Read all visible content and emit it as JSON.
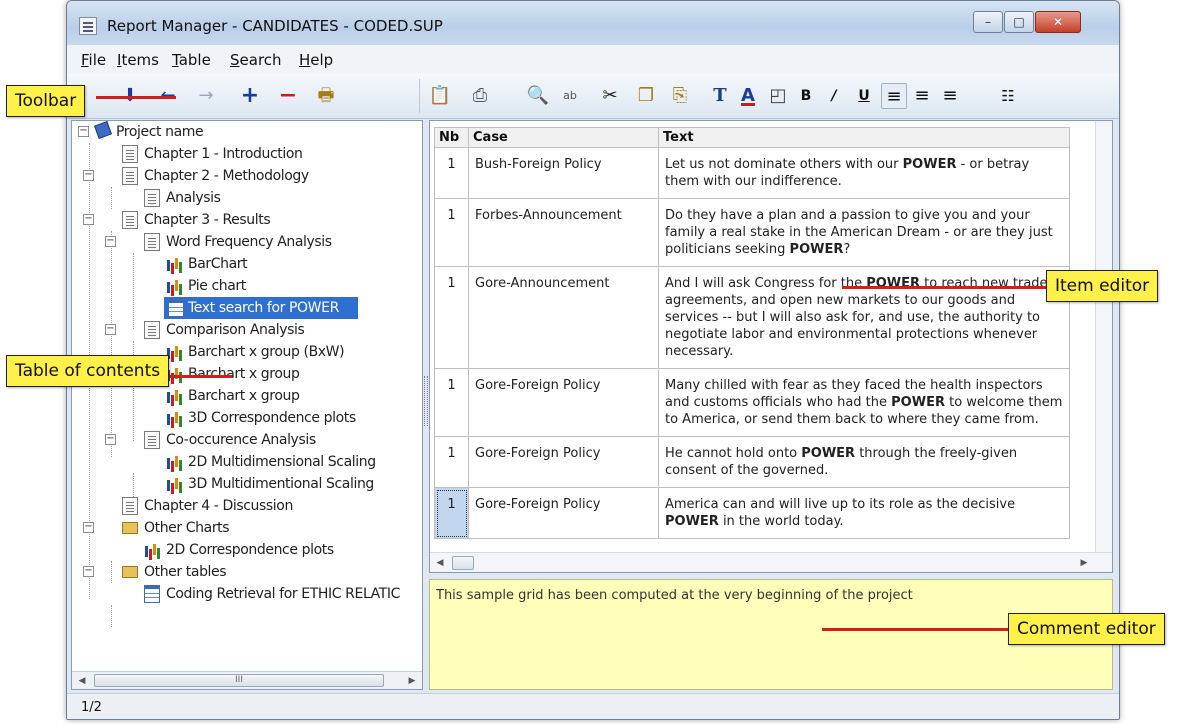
{
  "window": {
    "title": "Report Manager - CANDIDATES - CODED.SUP",
    "buttons": {
      "minimize": "–",
      "maximize": "□",
      "close": "✕"
    }
  },
  "menu": {
    "items": [
      {
        "accel": "F",
        "rest": "ile"
      },
      {
        "accel": "I",
        "rest": "tems"
      },
      {
        "accel": "T",
        "rest": "able"
      },
      {
        "accel": "S",
        "rest": "earch"
      },
      {
        "accel": "H",
        "rest": "elp"
      }
    ]
  },
  "toolbar": {
    "icons": [
      "move-down-arrow-icon",
      "move-left-arrow-icon",
      "move-right-arrow-icon",
      "add-icon",
      "remove-icon",
      "export-icon",
      "copy-to-report-icon",
      "print-icon",
      "find-icon",
      "spelling-icon",
      "cut-icon",
      "copy-icon",
      "paste-icon",
      "font-icon",
      "font-color-icon",
      "fill-color-icon",
      "bold-icon",
      "italic-icon",
      "underline-icon",
      "align-left-icon",
      "align-center-icon",
      "align-right-icon",
      "list-icon"
    ],
    "glyphs": {
      "down": "🡫",
      "left": "←",
      "right": "→",
      "add": "+",
      "remove": "−",
      "bold": "B",
      "italic": "/",
      "underline": "U",
      "cut": "✂",
      "find": "🔭",
      "align_left": "≡",
      "align_center": "≡",
      "align_right": "≡",
      "font": "T",
      "font_color": "A"
    }
  },
  "tree": {
    "items": [
      {
        "label": "Project name",
        "icon": "book"
      },
      {
        "label": "Chapter 1 - Introduction",
        "icon": "doc"
      },
      {
        "label": "Chapter 2 - Methodology",
        "icon": "doc"
      },
      {
        "label": "Analysis",
        "icon": "doc"
      },
      {
        "label": "Chapter 3 - Results",
        "icon": "doc"
      },
      {
        "label": "Word Frequency Analysis",
        "icon": "doc"
      },
      {
        "label": "BarChart",
        "icon": "chart"
      },
      {
        "label": "Pie chart",
        "icon": "chart"
      },
      {
        "label": "Text search for POWER",
        "icon": "table",
        "selected": true
      },
      {
        "label": "Comparison Analysis",
        "icon": "doc"
      },
      {
        "label": "Barchart x group (BxW)",
        "icon": "chart"
      },
      {
        "label": "Barchart x group",
        "icon": "chart"
      },
      {
        "label": "Barchart x group",
        "icon": "chart"
      },
      {
        "label": "3D Correspondence plots",
        "icon": "chart"
      },
      {
        "label": "Co-occurence Analysis",
        "icon": "doc"
      },
      {
        "label": "2D Multidimensional Scaling",
        "icon": "chart"
      },
      {
        "label": "3D Multidimentional Scaling",
        "icon": "chart"
      },
      {
        "label": "Chapter 4 - Discussion",
        "icon": "doc"
      },
      {
        "label": "Other Charts",
        "icon": "folder"
      },
      {
        "label": "2D Correspondence plots",
        "icon": "chart"
      },
      {
        "label": "Other tables",
        "icon": "folder"
      },
      {
        "label": "Coding Retrieval for ETHIC RELATIC",
        "icon": "table"
      }
    ],
    "scroll_thumb": "III"
  },
  "grid": {
    "columns": [
      "Nb",
      "Case",
      "Text"
    ],
    "rows": [
      {
        "nb": "1",
        "case": "Bush-Foreign Policy",
        "pre": "Let us not dominate others with our ",
        "kw": "POWER",
        "post": " - or betray them with our indifference."
      },
      {
        "nb": "1",
        "case": "Forbes-Announcement",
        "pre": "Do they have a plan and a passion to give you and your family a real stake in the American Dream - or are they just politicians seeking ",
        "kw": "POWER",
        "post": "?"
      },
      {
        "nb": "1",
        "case": "Gore-Announcement",
        "pre": "And I will ask Congress for the ",
        "kw": "POWER",
        "post": " to reach new trade agreements, and open new markets to our goods and services -- but I will also ask for, and use, the authority to negotiate labor and environmental protections whenever necessary."
      },
      {
        "nb": "1",
        "case": "Gore-Foreign Policy",
        "pre": "Many chilled with fear as they faced the health inspectors and customs officials who had the ",
        "kw": "POWER",
        "post": " to welcome them to America, or send them back to where they came from."
      },
      {
        "nb": "1",
        "case": "Gore-Foreign Policy",
        "pre": "He cannot hold onto ",
        "kw": "POWER",
        "post": " through the freely-given consent of the governed."
      },
      {
        "nb": "1",
        "case": "Gore-Foreign Policy",
        "pre": "America can and will live up to its role as the decisive ",
        "kw": "POWER",
        "post": " in the world today."
      }
    ]
  },
  "comment": {
    "text": "This sample grid has been computed at the very beginning of the project"
  },
  "status": {
    "page": "1/2"
  },
  "callouts": {
    "toolbar": "Toolbar",
    "table_of_contents": "Table of contents",
    "item_editor": "Item editor",
    "comment_editor": "Comment editor"
  },
  "colors": {
    "callout_fill": "#fff04a",
    "callout_line": "#d41e1e",
    "selection": "#2f6fcf",
    "comment_bg": "#ffffb9"
  }
}
